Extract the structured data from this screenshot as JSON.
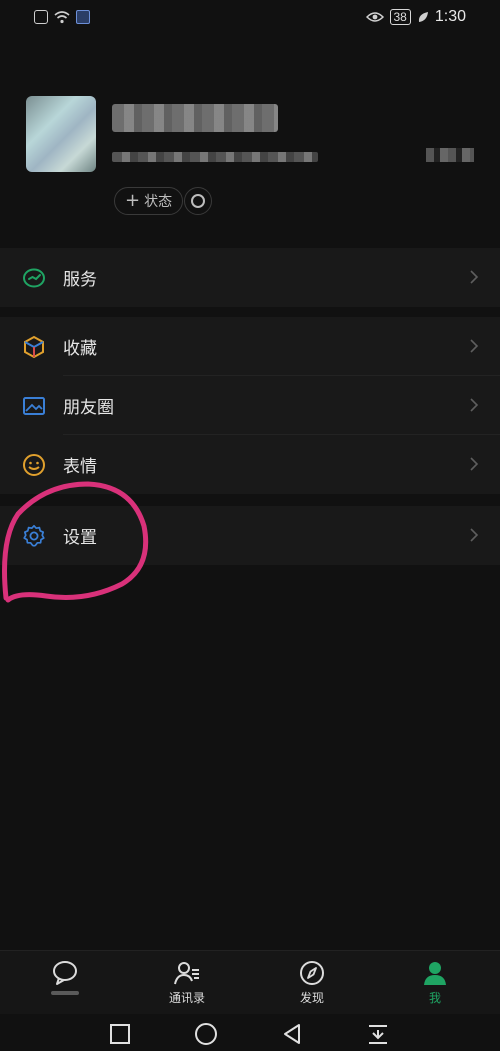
{
  "status_bar": {
    "time": "1:30",
    "battery": "38",
    "icons": [
      "alert-icon",
      "wifi-icon",
      "media-icon",
      "eye-icon",
      "leaf-icon"
    ]
  },
  "profile": {
    "status_button_label": "状态",
    "status_button_prefix": "+"
  },
  "menu": {
    "groups": [
      [
        {
          "label": "服务",
          "icon": "service-icon",
          "color": "#1fa463"
        }
      ],
      [
        {
          "label": "收藏",
          "icon": "favorites-icon",
          "color": "#e0a02d"
        },
        {
          "label": "朋友圈",
          "icon": "moments-icon",
          "color": "#3a7fd6"
        },
        {
          "label": "表情",
          "icon": "sticker-icon",
          "color": "#e0a02d"
        }
      ],
      [
        {
          "label": "设置",
          "icon": "settings-icon",
          "color": "#3a7fd6"
        }
      ]
    ]
  },
  "tabbar": {
    "tabs": [
      {
        "label": "",
        "icon": "chat-icon"
      },
      {
        "label": "通讯录",
        "icon": "contacts-icon"
      },
      {
        "label": "发现",
        "icon": "discover-icon"
      },
      {
        "label": "我",
        "icon": "me-icon",
        "active": true
      }
    ]
  },
  "colors": {
    "accent": "#1fa463",
    "annotation": "#d9317a",
    "background": "#111111",
    "card": "#191919"
  }
}
